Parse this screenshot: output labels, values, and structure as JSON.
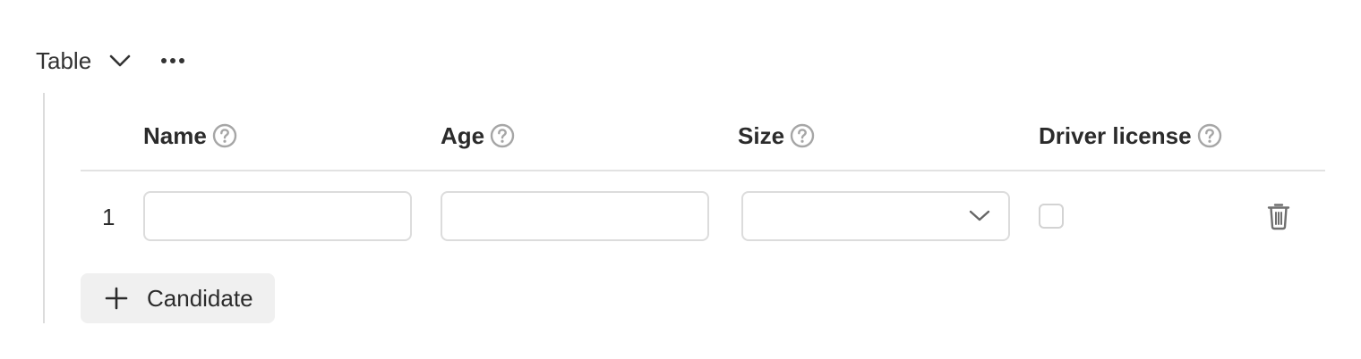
{
  "header": {
    "title": "Table",
    "chevron_icon": "chevron-down-icon",
    "more_icon": "more-horizontal-icon"
  },
  "table": {
    "columns": [
      {
        "label": "Name",
        "help_icon": "question-circle-icon"
      },
      {
        "label": "Age",
        "help_icon": "question-circle-icon"
      },
      {
        "label": "Size",
        "help_icon": "question-circle-icon"
      },
      {
        "label": "Driver license",
        "help_icon": "question-circle-icon"
      }
    ],
    "rows": [
      {
        "index": "1",
        "name": "",
        "age": "",
        "size": "",
        "driver_license": false
      }
    ],
    "delete_icon": "trash-icon"
  },
  "add_button": {
    "label": "Candidate",
    "icon": "plus-icon"
  },
  "colors": {
    "text": "#2b2b2b",
    "border": "#dcdcdc",
    "icon_gray": "#a6a6a6",
    "button_bg": "#f0f0f0"
  }
}
